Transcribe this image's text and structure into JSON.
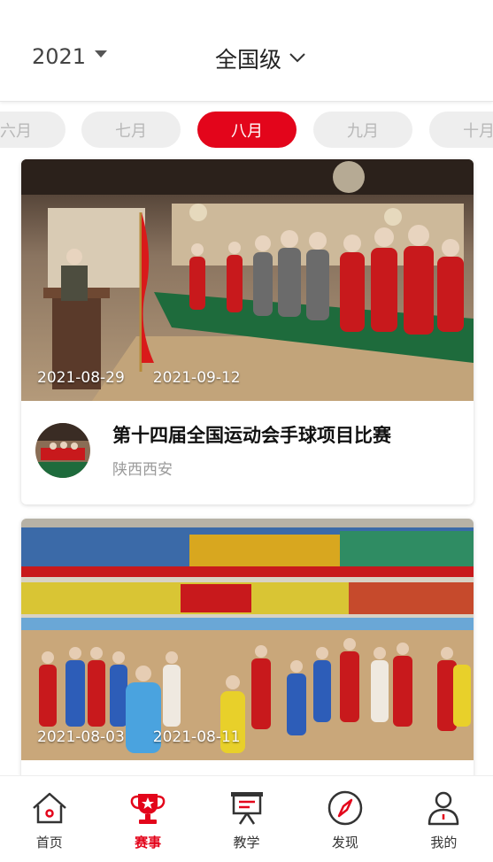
{
  "header": {
    "year": "2021",
    "level": "全国级"
  },
  "months": [
    {
      "label": "六月",
      "active": false
    },
    {
      "label": "七月",
      "active": false
    },
    {
      "label": "八月",
      "active": true
    },
    {
      "label": "九月",
      "active": false
    },
    {
      "label": "十月",
      "active": false
    }
  ],
  "events": [
    {
      "start_date": "2021-08-29",
      "end_date": "2021-09-12",
      "title": "第十四届全国运动会手球项目比赛",
      "location": "陕西西安"
    },
    {
      "start_date": "2021-08-03",
      "end_date": "2021-08-11"
    }
  ],
  "tabbar": [
    {
      "label": "首页",
      "icon": "home-icon",
      "active": false
    },
    {
      "label": "赛事",
      "icon": "trophy-icon",
      "active": true
    },
    {
      "label": "教学",
      "icon": "teaching-board-icon",
      "active": false
    },
    {
      "label": "发现",
      "icon": "compass-icon",
      "active": false
    },
    {
      "label": "我的",
      "icon": "profile-icon",
      "active": false
    }
  ],
  "colors": {
    "accent": "#e3051b",
    "inactive_pill": "#eeeeee",
    "inactive_text": "#b8b8b8"
  }
}
